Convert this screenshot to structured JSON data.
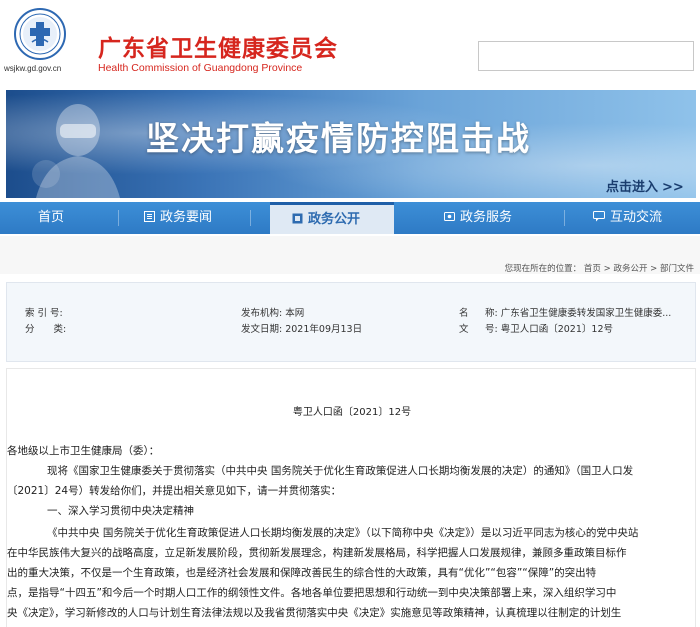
{
  "header": {
    "site_url": "wsjkw.gd.gov.cn",
    "title_cn": "广东省卫生健康委员会",
    "title_en": "Health Commission of Guangdong Province",
    "search_placeholder": ""
  },
  "banner": {
    "title": "坚决打赢疫情防控阻击战",
    "link_label": "点击进入",
    "link_arrows": ">>"
  },
  "nav": {
    "items": [
      {
        "label": "首页",
        "icon": "none"
      },
      {
        "label": "政务要闻",
        "icon": "news-icon"
      },
      {
        "label": "政务公开",
        "icon": "disclosure-icon",
        "active": true
      },
      {
        "label": "政务服务",
        "icon": "service-icon"
      },
      {
        "label": "互动交流",
        "icon": "interaction-icon"
      }
    ]
  },
  "breadcrumb": {
    "prefix": "您现在所在的位置：",
    "items": [
      "首页",
      "政务公开",
      "部门文件"
    ],
    "sep": ">"
  },
  "info": {
    "index_label": "索 引 号:",
    "index_value": "",
    "category_label": "分　　类:",
    "category_value": "",
    "publisher": "发布机构: 本网",
    "date": "发文日期: 2021年09月13日",
    "name_label": "名",
    "name_value": "称: 广东省卫生健康委转发国家卫生健康委...",
    "docno_label": "文",
    "docno_value": "号: 粤卫人口函〔2021〕12号"
  },
  "document": {
    "doc_number": "粤卫人口函〔2021〕12号",
    "addressee": "各地级以上市卫生健康局（委）：",
    "para1_line1": "现将《国家卫生健康委关于贯彻落实（中共中央 国务院关于优化生育政策促进人口长期均衡发展的决定）的通知》（国卫人口发",
    "para1_line2": "〔2021〕24号）转发给你们，并提出相关意见如下，请一并贯彻落实：",
    "section1": "一、深入学习贯彻中央决定精神",
    "para2_line1": "《中共中央 国务院关于优化生育政策促进人口长期均衡发展的决定》（以下简称中央《决定》）是以习近平同志为核心的党中央站",
    "para2_line2": "在中华民族伟大复兴的战略高度，立足新发展阶段，贯彻新发展理念，构建新发展格局，科学把握人口发展规律，兼顾多重政策目标作",
    "para2_line3": "出的重大决策，不仅是一个生育政策，也是经济社会发展和保障改善民生的综合性的大政策，具有“优化”“包容”“保障”的突出特",
    "para2_line4": "点，是指导“十四五”和今后一个时期人口工作的纲领性文件。各地各单位要把思想和行动统一到中央决策部署上来，深入组织学习中",
    "para2_line5": "央《决定》，学习新修改的人口与计划生育法律法规以及我省贯彻落实中央《决定》实施意见等政策精神，认真梳理以往制定的计划生"
  },
  "colors": {
    "brand_red": "#d6261e",
    "nav_blue": "#2e7ac5",
    "active_tab_bg": "#dfe9f4",
    "banner_blue": "#3a73b6"
  }
}
